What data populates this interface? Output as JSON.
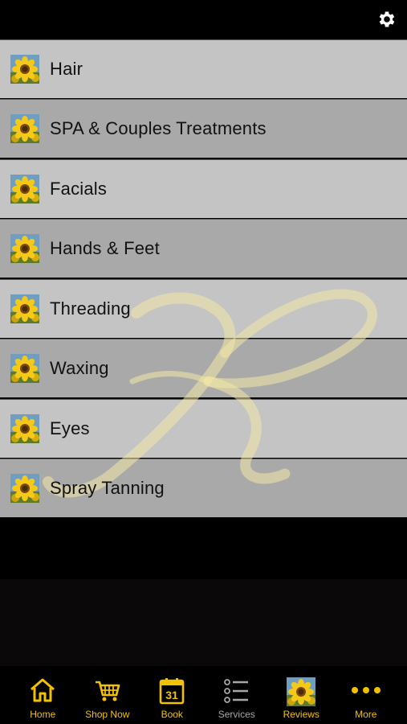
{
  "header": {
    "settings_icon": "gear-icon"
  },
  "watermark_icon": "k-monogram-watermark",
  "services": [
    {
      "label": "Hair",
      "icon": "sunflower-thumbnail"
    },
    {
      "label": "SPA & Couples Treatments",
      "icon": "sunflower-thumbnail"
    },
    {
      "label": "Facials",
      "icon": "sunflower-thumbnail"
    },
    {
      "label": "Hands & Feet",
      "icon": "sunflower-thumbnail"
    },
    {
      "label": "Threading",
      "icon": "sunflower-thumbnail"
    },
    {
      "label": "Waxing",
      "icon": "sunflower-thumbnail"
    },
    {
      "label": "Eyes",
      "icon": "sunflower-thumbnail"
    },
    {
      "label": "Spray Tanning",
      "icon": "sunflower-thumbnail"
    }
  ],
  "tabbar": {
    "items": [
      {
        "label": "Home",
        "icon": "home-icon"
      },
      {
        "label": "Shop Now",
        "icon": "cart-icon"
      },
      {
        "label": "Book",
        "icon": "calendar-icon",
        "day": "31"
      },
      {
        "label": "Services",
        "icon": "list-icon"
      },
      {
        "label": "Reviews",
        "icon": "sunflower-thumbnail"
      },
      {
        "label": "More",
        "icon": "more-dots-icon"
      }
    ]
  },
  "colors": {
    "accent": "#f2c200",
    "row_light": "#c4c4c4",
    "row_dark": "#a9a9a9",
    "inactive": "#a7a7a7"
  }
}
